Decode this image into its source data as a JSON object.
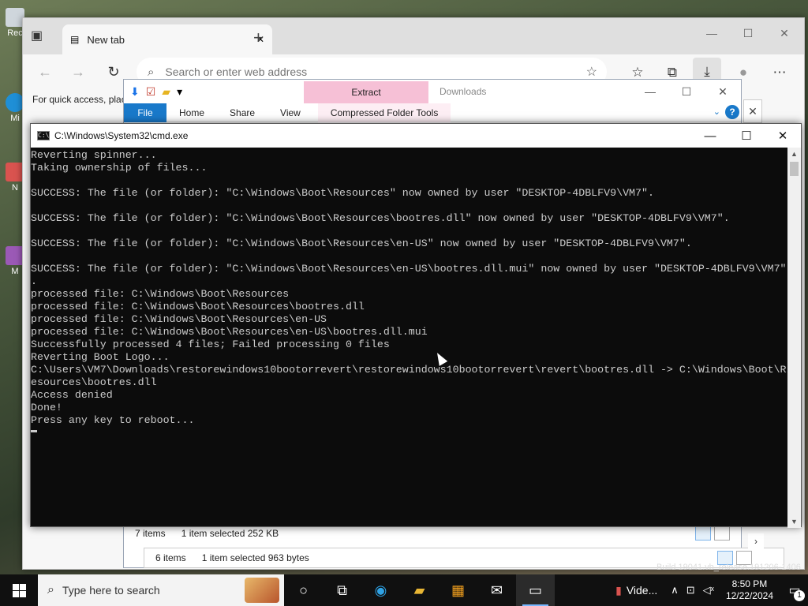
{
  "desktop": {
    "icons": [
      {
        "label": "Rec"
      },
      {
        "label": "Mi"
      },
      {
        "label": "N"
      },
      {
        "label": "M"
      }
    ]
  },
  "edge": {
    "tab_title": "New tab",
    "address_placeholder": "Search or enter web address",
    "favbar_text": "For quick access, plac"
  },
  "explorer": {
    "title": "Downloads",
    "contextual_tab": "Extract",
    "ribbon_tabs": [
      "File",
      "Home",
      "Share",
      "View",
      "Compressed Folder Tools"
    ],
    "status_items": "7 items",
    "status_selected": "1 item selected  252 KB"
  },
  "explorer2": {
    "status_items": "6 items",
    "status_selected": "1 item selected  963 bytes"
  },
  "cmd": {
    "title": "C:\\Windows\\System32\\cmd.exe",
    "lines": [
      "Reverting spinner...",
      "Taking ownership of files...",
      "",
      "SUCCESS: The file (or folder): \"C:\\Windows\\Boot\\Resources\" now owned by user \"DESKTOP-4DBLFV9\\VM7\".",
      "",
      "SUCCESS: The file (or folder): \"C:\\Windows\\Boot\\Resources\\bootres.dll\" now owned by user \"DESKTOP-4DBLFV9\\VM7\".",
      "",
      "SUCCESS: The file (or folder): \"C:\\Windows\\Boot\\Resources\\en-US\" now owned by user \"DESKTOP-4DBLFV9\\VM7\".",
      "",
      "SUCCESS: The file (or folder): \"C:\\Windows\\Boot\\Resources\\en-US\\bootres.dll.mui\" now owned by user \"DESKTOP-4DBLFV9\\VM7\"",
      ".",
      "processed file: C:\\Windows\\Boot\\Resources",
      "processed file: C:\\Windows\\Boot\\Resources\\bootres.dll",
      "processed file: C:\\Windows\\Boot\\Resources\\en-US",
      "processed file: C:\\Windows\\Boot\\Resources\\en-US\\bootres.dll.mui",
      "Successfully processed 4 files; Failed processing 0 files",
      "Reverting Boot Logo...",
      "C:\\Users\\VM7\\Downloads\\restorewindows10bootorrevert\\restorewindows10bootorrevert\\revert\\bootres.dll -> C:\\Windows\\Boot\\R",
      "esources\\bootres.dll",
      "Access denied",
      "Done!",
      "Press any key to reboot..."
    ]
  },
  "watermark": "Build 19041.vb_release.191206-1406",
  "taskbar": {
    "search_placeholder": "Type here to search",
    "video_label": "Vide...",
    "time": "8:50 PM",
    "date": "12/22/2024",
    "notification_count": "1"
  },
  "colors": {
    "cmd_bg": "#0c0c0c",
    "cmd_fg": "#cccccc",
    "ribbon_file": "#1979ca",
    "extract_tab": "#f6c0d6"
  }
}
